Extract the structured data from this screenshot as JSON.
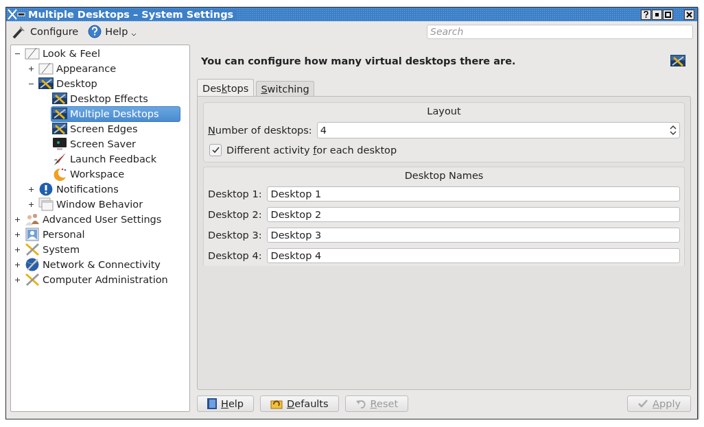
{
  "window": {
    "title": "Multiple Desktops – System Settings"
  },
  "toolbar": [
    {
      "label": "Configure",
      "menu": false
    },
    {
      "label": "Help",
      "menu": true
    }
  ],
  "search": {
    "placeholder": "Search"
  },
  "tree": [
    {
      "label": "Look & Feel",
      "expanded": true,
      "selected": false,
      "children": [
        {
          "label": "Appearance",
          "expanded": false,
          "selected": false
        },
        {
          "label": "Desktop",
          "expanded": true,
          "selected": false,
          "children": [
            {
              "label": "Desktop Effects",
              "selected": false
            },
            {
              "label": "Multiple Desktops",
              "selected": true
            },
            {
              "label": "Screen Edges",
              "selected": false
            },
            {
              "label": "Screen Saver",
              "selected": false
            },
            {
              "label": "Launch Feedback",
              "selected": false
            },
            {
              "label": "Workspace",
              "selected": false
            }
          ]
        },
        {
          "label": "Notifications",
          "expanded": false,
          "selected": false
        },
        {
          "label": "Window Behavior",
          "expanded": false,
          "selected": false
        }
      ]
    },
    {
      "label": "Advanced User Settings",
      "expanded": false,
      "selected": false
    },
    {
      "label": "Personal",
      "expanded": false,
      "selected": false
    },
    {
      "label": "System",
      "expanded": false,
      "selected": false
    },
    {
      "label": "Network & Connectivity",
      "expanded": false,
      "selected": false
    },
    {
      "label": "Computer Administration",
      "expanded": false,
      "selected": false
    }
  ],
  "header": {
    "text": "You can configure how many virtual desktops there are."
  },
  "tabs": [
    {
      "label": {
        "before": "Des",
        "key": "k",
        "after": "tops"
      },
      "selected": true
    },
    {
      "label": {
        "key": "S",
        "after": "witching"
      },
      "selected": false
    }
  ],
  "layout_group": {
    "title": "Layout",
    "count_label": {
      "key": "N",
      "after": "umber of desktops:"
    },
    "count_value": "4",
    "activity_checkbox": {
      "label": {
        "before": "Different activity ",
        "key": "f",
        "after": "or each desktop"
      },
      "checked": true
    }
  },
  "names_group": {
    "title": "Desktop Names",
    "rows": [
      {
        "label": "Desktop 1:",
        "value": "Desktop 1"
      },
      {
        "label": "Desktop 2:",
        "value": "Desktop 2"
      },
      {
        "label": "Desktop 3:",
        "value": "Desktop 3"
      },
      {
        "label": "Desktop 4:",
        "value": "Desktop 4"
      }
    ]
  },
  "buttons": [
    {
      "label": {
        "key": "H",
        "after": "elp"
      },
      "disabled": false
    },
    {
      "label": {
        "key": "D",
        "after": "efaults"
      },
      "disabled": false
    },
    {
      "label": {
        "key": "R",
        "after": "eset"
      },
      "disabled": true
    },
    {
      "label": {
        "key": "A",
        "after": "pply"
      },
      "disabled": true
    }
  ]
}
